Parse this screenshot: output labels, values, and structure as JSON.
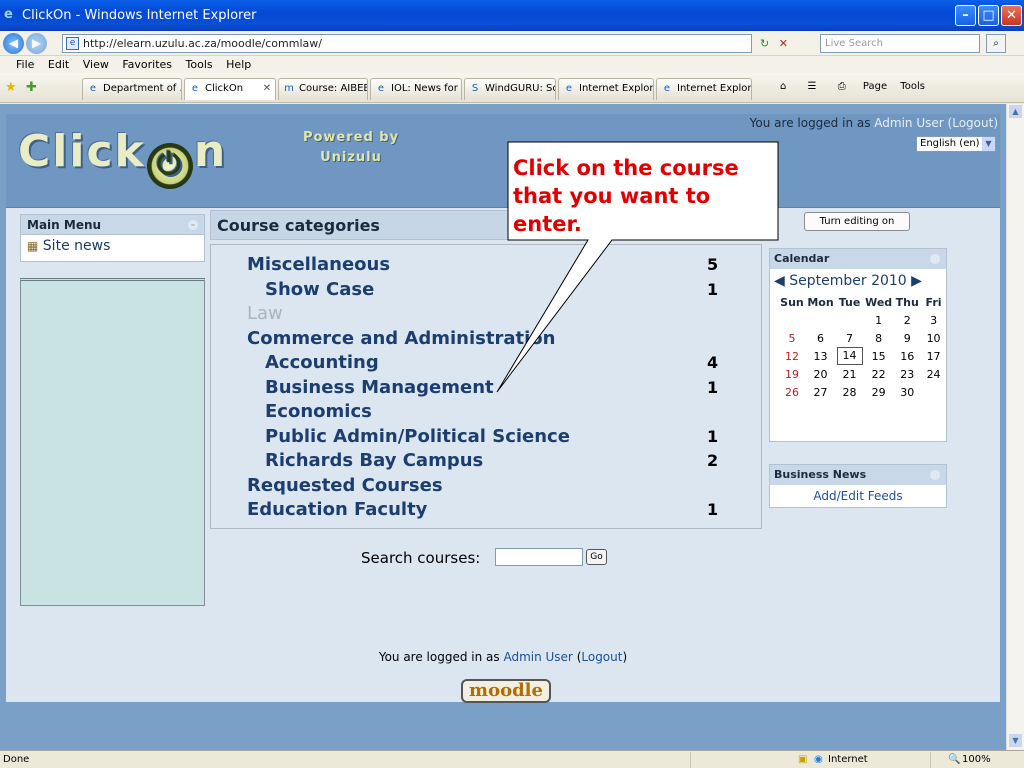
{
  "window": {
    "title": "ClickOn - Windows Internet Explorer",
    "minimize": "–",
    "maximize": "□",
    "close": "✕"
  },
  "address": {
    "url": "http://elearn.uzulu.ac.za/moodle/commlaw/",
    "search_placeholder": "Live Search"
  },
  "menu": [
    "File",
    "Edit",
    "View",
    "Favorites",
    "Tools",
    "Help"
  ],
  "tabs": [
    {
      "label": "Department of ...",
      "active": false
    },
    {
      "label": "ClickOn",
      "active": true
    },
    {
      "label": "Course: AIBEB...",
      "active": false
    },
    {
      "label": "IOL: News for ...",
      "active": false
    },
    {
      "label": "WindGURU: So...",
      "active": false
    },
    {
      "label": "Internet Explor...",
      "active": false
    },
    {
      "label": "Internet Explor...",
      "active": false
    }
  ],
  "command_bar": {
    "page": "Page",
    "tools": "Tools"
  },
  "header": {
    "logo_left": "Click",
    "logo_right": "n",
    "powered_line1": "Powered by",
    "powered_line2": "Unizulu",
    "logged_prefix": "You are logged in as ",
    "user": "Admin User",
    "logout": "(Logout)",
    "language": "English (en)"
  },
  "main_menu": {
    "title": "Main Menu",
    "items": [
      "Site news"
    ]
  },
  "course_categories": {
    "title": "Course categories",
    "items": [
      {
        "name": "Miscellaneous",
        "count": "5",
        "level": 0,
        "dimmed": false
      },
      {
        "name": "Show Case",
        "count": "1",
        "level": 1,
        "dimmed": false
      },
      {
        "name": "Law",
        "count": "",
        "level": 0,
        "dimmed": true
      },
      {
        "name": "Commerce and Administration",
        "count": "",
        "level": 0,
        "dimmed": false
      },
      {
        "name": "Accounting",
        "count": "4",
        "level": 1,
        "dimmed": false
      },
      {
        "name": "Business Management",
        "count": "1",
        "level": 1,
        "dimmed": false
      },
      {
        "name": "Economics",
        "count": "",
        "level": 1,
        "dimmed": false
      },
      {
        "name": "Public Admin/Political Science",
        "count": "1",
        "level": 1,
        "dimmed": false
      },
      {
        "name": "Richards Bay Campus",
        "count": "2",
        "level": 1,
        "dimmed": false
      },
      {
        "name": "Requested Courses",
        "count": "",
        "level": 0,
        "dimmed": false
      },
      {
        "name": "Education Faculty",
        "count": "1",
        "level": 0,
        "dimmed": false
      }
    ]
  },
  "search": {
    "label": "Search courses:",
    "go": "Go"
  },
  "turn_editing": "Turn editing on",
  "calendar": {
    "title": "Calendar",
    "month": "September 2010",
    "days": [
      "Sun",
      "Mon",
      "Tue",
      "Wed",
      "Thu",
      "Fri"
    ],
    "weeks": [
      [
        "",
        "",
        "",
        "1",
        "2",
        "3"
      ],
      [
        "5",
        "6",
        "7",
        "8",
        "9",
        "10"
      ],
      [
        "12",
        "13",
        "14",
        "15",
        "16",
        "17"
      ],
      [
        "19",
        "20",
        "21",
        "22",
        "23",
        "24"
      ],
      [
        "26",
        "27",
        "28",
        "29",
        "30",
        ""
      ]
    ],
    "today": "14"
  },
  "business_news": {
    "title": "Business News",
    "link": "Add/Edit Feeds"
  },
  "footer": {
    "logged_prefix": "You are logged in as ",
    "user": "Admin User",
    "logout_open": " (",
    "logout": "Logout",
    "logout_close": ")",
    "moodle": "moodle"
  },
  "callout": "Click on the course that you want to enter.",
  "status": {
    "left": "Done",
    "zone": "Internet",
    "zoom": "100%"
  },
  "colors": {
    "callout_text": "#e00000",
    "link": "#1c4f9c",
    "category": "#1c3e6e"
  }
}
